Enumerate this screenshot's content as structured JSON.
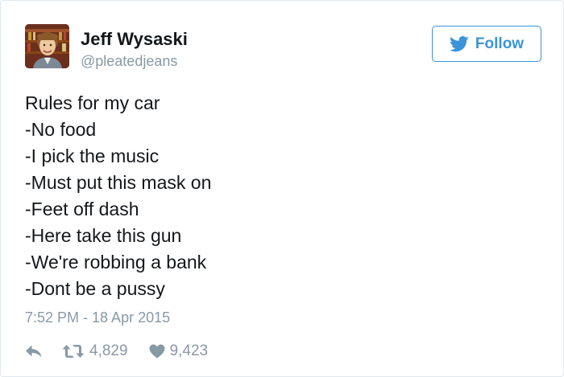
{
  "user": {
    "name": "Jeff Wysaski",
    "handle": "@pleatedjeans"
  },
  "follow_button": {
    "label": "Follow",
    "icon": "twitter-bird-icon",
    "color": "#3b94d9"
  },
  "tweet": {
    "lines": [
      "Rules for my car",
      "-No food",
      "-I pick the music",
      "-Must put this mask on",
      "-Feet off dash",
      "-Here take this gun",
      "-We're robbing a bank",
      "-Dont be a pussy"
    ],
    "timestamp": "7:52 PM - 18 Apr 2015"
  },
  "actions": {
    "reply_icon": "reply-icon",
    "retweet_icon": "retweet-icon",
    "retweet_count": "4,829",
    "like_icon": "heart-icon",
    "like_count": "9,423"
  },
  "colors": {
    "text": "#14171a",
    "muted": "#8899a6",
    "border": "#e1e8ed"
  }
}
